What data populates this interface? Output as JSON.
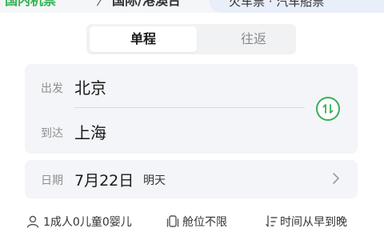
{
  "top_tabs": {
    "domestic": "国内机票",
    "chevron": "〉",
    "international": "国际/港澳台",
    "right_tab": "火车票 · 汽车船票"
  },
  "trip_type": {
    "one_way": "单程",
    "round_trip": "往返"
  },
  "route": {
    "from_label": "出发",
    "from_city": "北京",
    "to_label": "到达",
    "to_city": "上海"
  },
  "date": {
    "label": "日期",
    "value": "7月22日",
    "relative": "明天"
  },
  "options": {
    "passengers": "1成人0儿童0婴儿",
    "cabin": "舱位不限",
    "sort": "时间从早到晚"
  },
  "colors": {
    "accent": "#35b255"
  }
}
